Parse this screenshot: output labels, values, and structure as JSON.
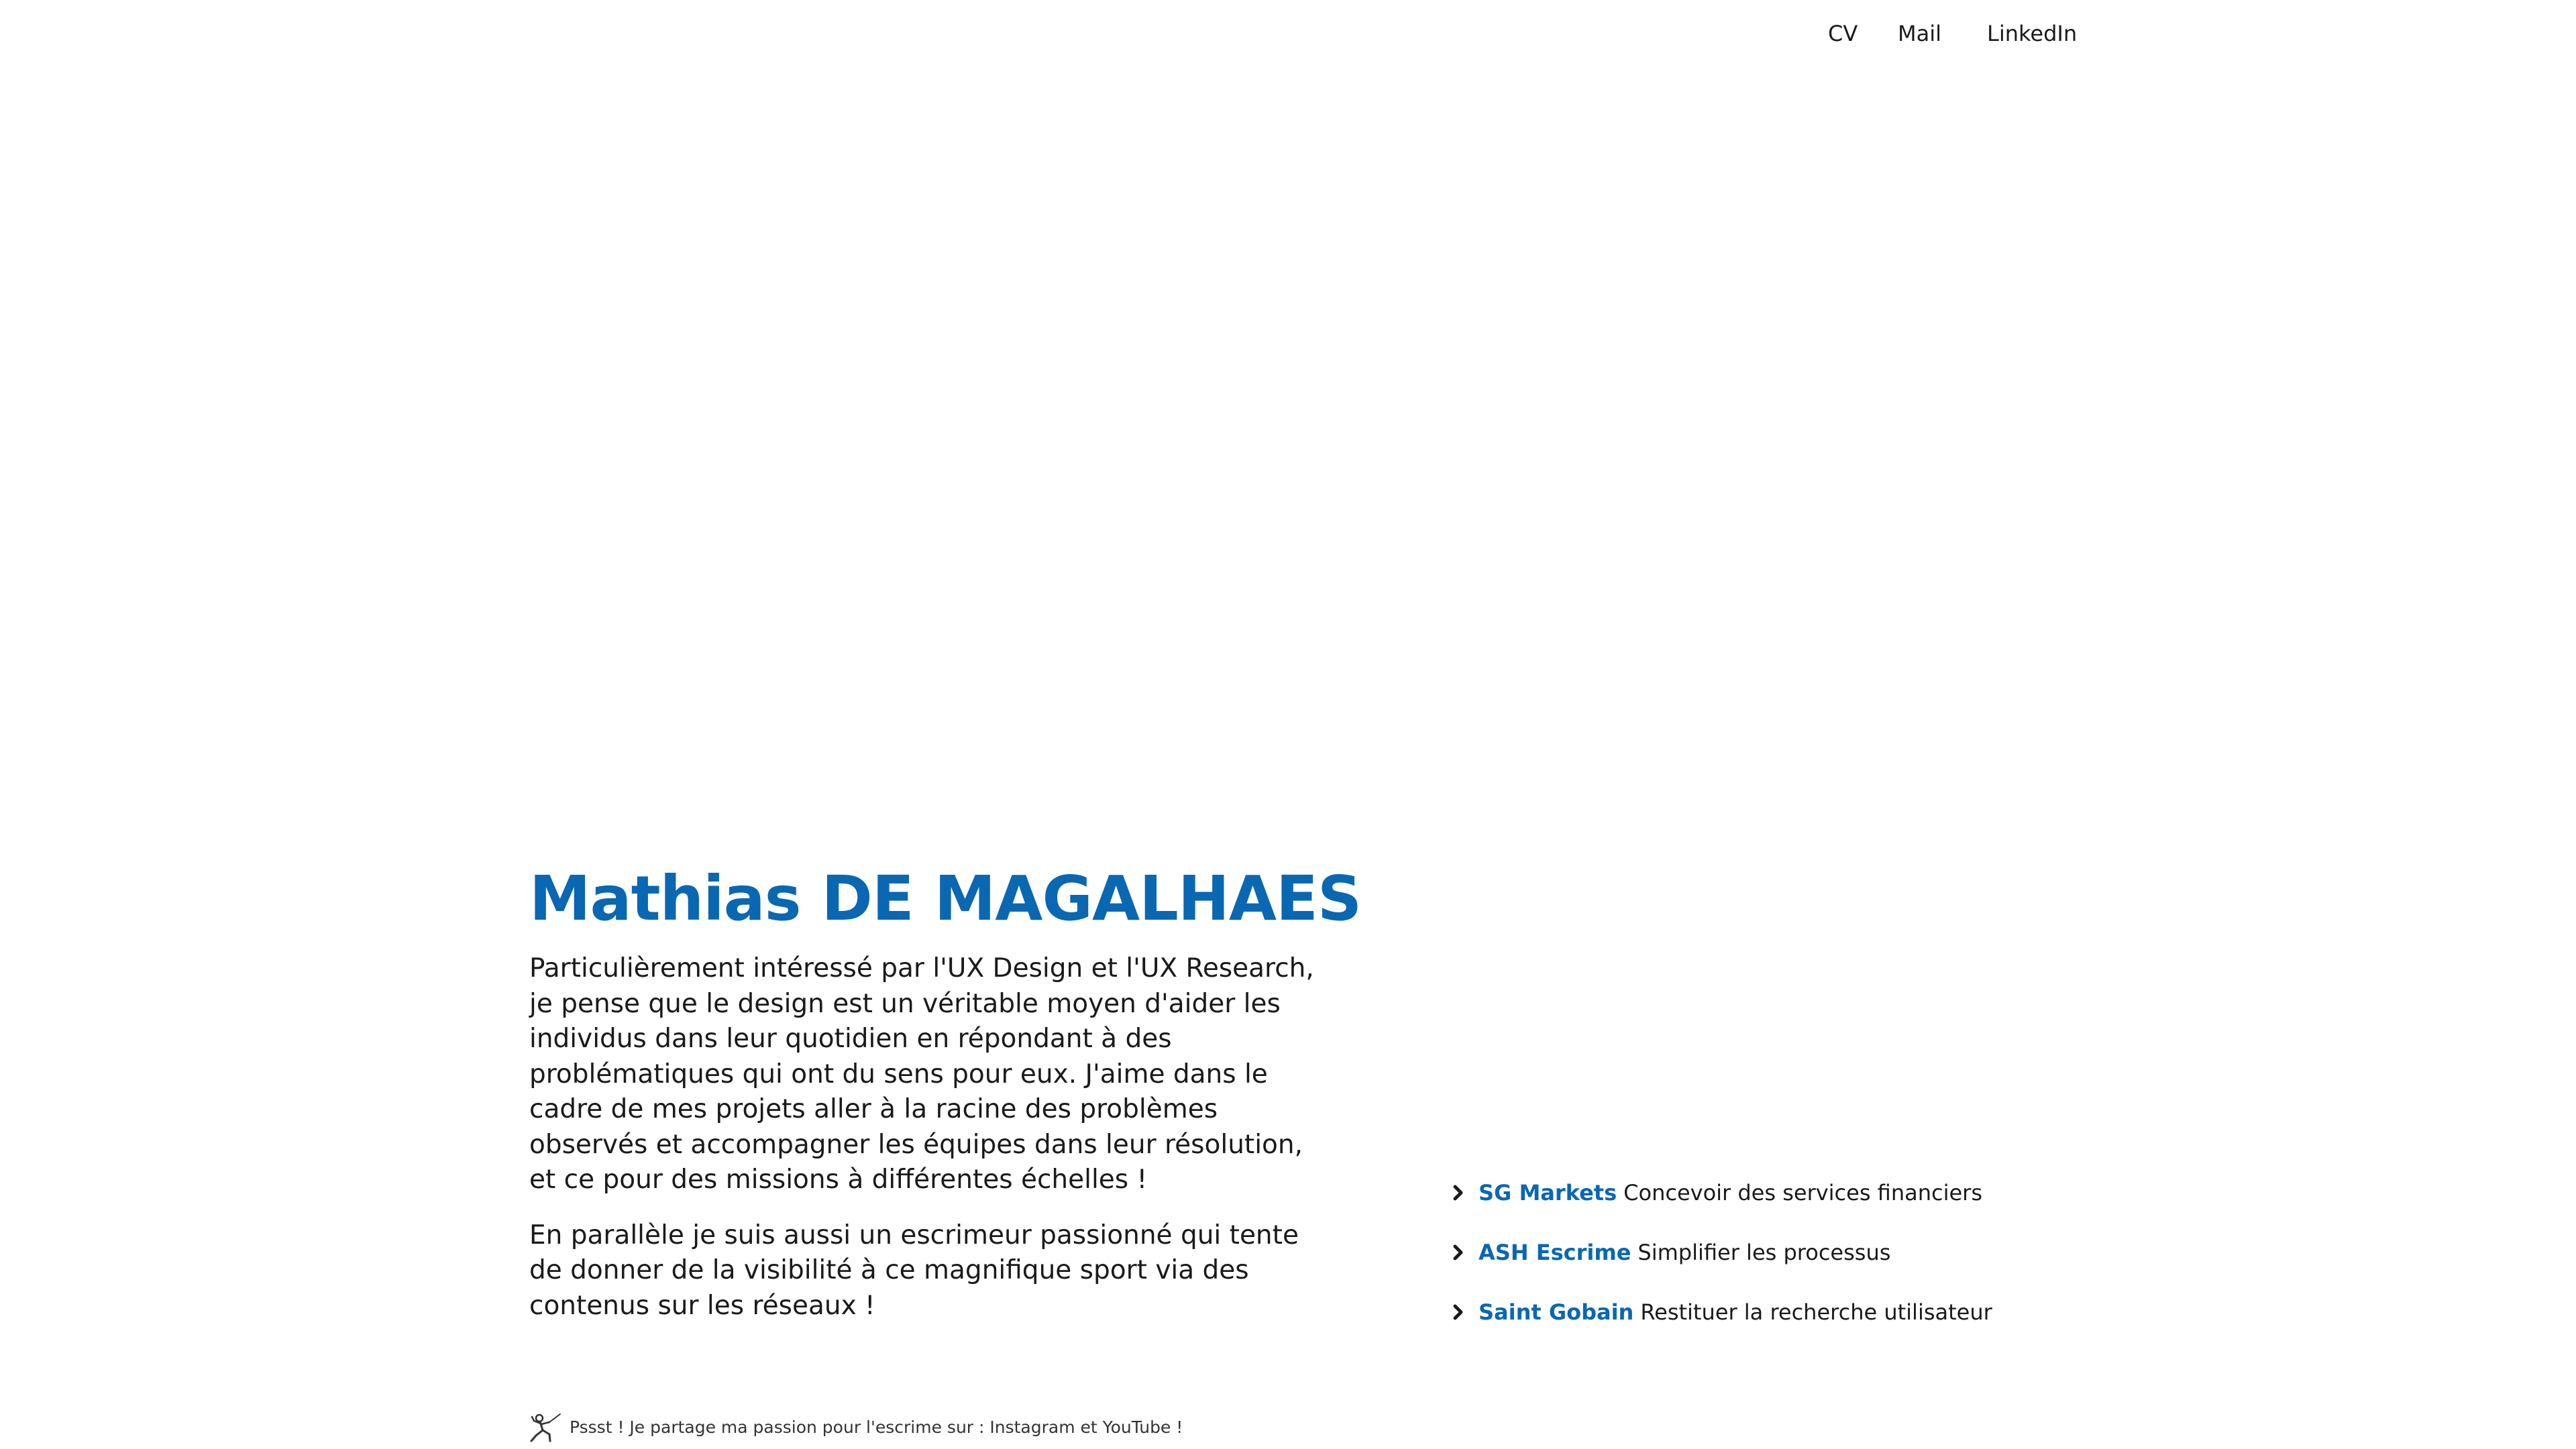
{
  "nav": {
    "cv": "CV",
    "mail": "Mail",
    "linkedin": "LinkedIn"
  },
  "intro": {
    "name": "Mathias DE MAGALHAES",
    "paragraph_1": "Particulièrement intéressé par l'UX Design et l'UX Research, je pense que le design est un véritable moyen d'aider les individus dans leur quotidien en répondant à des problématiques qui ont du sens pour eux. J'aime dans le cadre de mes projets aller à la racine des problèmes observés et accompagner les équipes dans leur résolution, et ce pour des missions à différentes échelles !",
    "paragraph_2": "En parallèle je suis aussi un escrimeur passionné qui tente de donner de la visibilité à ce magnifique sport via des contenus sur les réseaux !"
  },
  "projects": [
    {
      "name": "SG Markets",
      "description": "Concevoir des services financiers"
    },
    {
      "name": "ASH Escrime",
      "description": "Simplifier les processus"
    },
    {
      "name": "Saint Gobain",
      "description": "Restituer la recherche utilisateur"
    }
  ],
  "footnote": {
    "prefix": "Pssst ! Je partage ma passion pour l'escrime sur : ",
    "instagram": "Instagram",
    "connector": " et ",
    "youtube": "YouTube",
    "suffix": " !",
    "icon": "fencer-icon"
  },
  "colors": {
    "accent": "#0a67b2",
    "text": "#1a1a1a",
    "background": "#ffffff"
  }
}
